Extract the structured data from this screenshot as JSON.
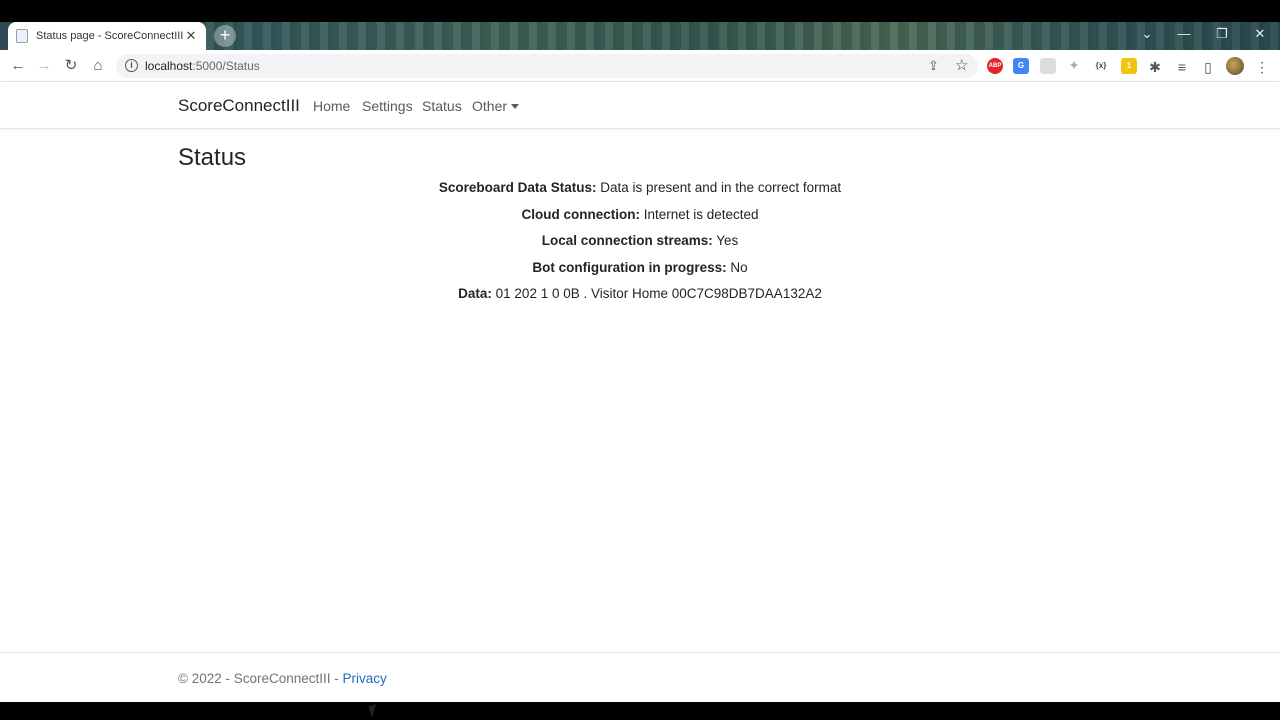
{
  "browser": {
    "tab_title": "Status page - ScoreConnectIII",
    "tab_close": "✕",
    "new_tab": "+",
    "url_host": "localhost",
    "url_path": ":5000/Status",
    "window_controls": [
      "⌄",
      "—",
      "❐",
      "✕"
    ],
    "extensions": [
      {
        "name": "adblock-extension-icon",
        "label": "ABP",
        "color": "#e4262b"
      },
      {
        "name": "translate-extension-icon",
        "label": "G",
        "color": "#4285f4"
      },
      {
        "name": "blank-extension-icon",
        "label": "",
        "color": "#dcdcdc"
      },
      {
        "name": "sparkle-extension-icon",
        "label": "✦",
        "color": "#9aa"
      },
      {
        "name": "braces-extension-icon",
        "label": "{x}",
        "color": "#555"
      },
      {
        "name": "note-extension-icon",
        "label": "1",
        "color": "#f1c40f"
      }
    ]
  },
  "navbar": {
    "brand": "ScoreConnectIII",
    "links": [
      "Home",
      "Settings",
      "Status"
    ],
    "dropdown": "Other"
  },
  "main": {
    "title": "Status",
    "status_items": [
      {
        "label": "Scoreboard Data Status:",
        "value": "Data is present and in the correct format"
      },
      {
        "label": "Cloud connection:",
        "value": "Internet is detected"
      },
      {
        "label": "Local connection streams:",
        "value": "Yes"
      },
      {
        "label": "Bot configuration in progress:",
        "value": "No"
      },
      {
        "label": "Data:",
        "value": "01 202 1 0 0B . Visitor Home 00C7C98DB7DAA132A2"
      }
    ]
  },
  "footer": {
    "copyright": "© 2022 - ScoreConnectIII - ",
    "privacy_link": "Privacy"
  }
}
